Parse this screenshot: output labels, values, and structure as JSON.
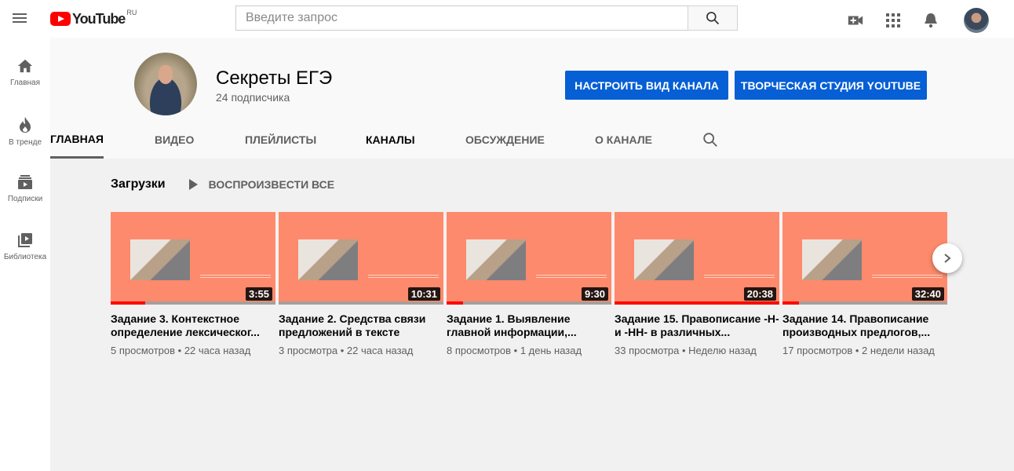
{
  "header": {
    "logo_text": "YouTube",
    "logo_region": "RU",
    "search_placeholder": "Введите запрос",
    "icons": [
      "menu-icon",
      "search-icon",
      "create-video-icon",
      "apps-icon",
      "notifications-icon",
      "account-avatar"
    ]
  },
  "sidebar": {
    "items": [
      {
        "label": "Главная",
        "icon": "home-icon"
      },
      {
        "label": "В тренде",
        "icon": "trending-icon"
      },
      {
        "label": "Подписки",
        "icon": "subscriptions-icon"
      },
      {
        "label": "Библиотека",
        "icon": "library-icon"
      }
    ]
  },
  "channel": {
    "title": "Секреты ЕГЭ",
    "subscribers": "24 подписчика",
    "customize_button": "НАСТРОИТЬ ВИД КАНАЛА",
    "studio_button": "ТВОРЧЕСКАЯ СТУДИЯ YOUTUBE",
    "tabs": [
      "ГЛАВНАЯ",
      "ВИДЕО",
      "ПЛЕЙЛИСТЫ",
      "КАНАЛЫ",
      "ОБСУЖДЕНИЕ",
      "О КАНАЛЕ"
    ],
    "active_tab": "ГЛАВНАЯ"
  },
  "uploads": {
    "title": "Загрузки",
    "play_all": "ВОСПРОИЗВЕСТИ ВСЕ",
    "videos": [
      {
        "title": "Задание 3. Контекстное определение лексическог...",
        "duration": "3:55",
        "meta": "5 просмотров • 22 часа назад",
        "watched_fraction": 0.21
      },
      {
        "title": "Задание 2. Средства связи предложений в тексте",
        "duration": "10:31",
        "meta": "3 просмотра • 22 часа назад",
        "watched_fraction": 0.0
      },
      {
        "title": "Задание 1. Выявление главной информации,...",
        "duration": "9:30",
        "meta": "8 просмотров • 1 день назад",
        "watched_fraction": 0.1
      },
      {
        "title": "Задание 15. Правописание -Н- и -НН- в различных...",
        "duration": "20:38",
        "meta": "33 просмотра • Неделю назад",
        "watched_fraction": 1.0
      },
      {
        "title": "Задание 14. Правописание производных предлогов,...",
        "duration": "32:40",
        "meta": "17 просмотров • 2 недели назад",
        "watched_fraction": 0.1
      }
    ]
  },
  "colors": {
    "accent_blue": "#065fd4",
    "brand_red": "#ff0000",
    "thumb_bg": "#fd8a6c"
  }
}
